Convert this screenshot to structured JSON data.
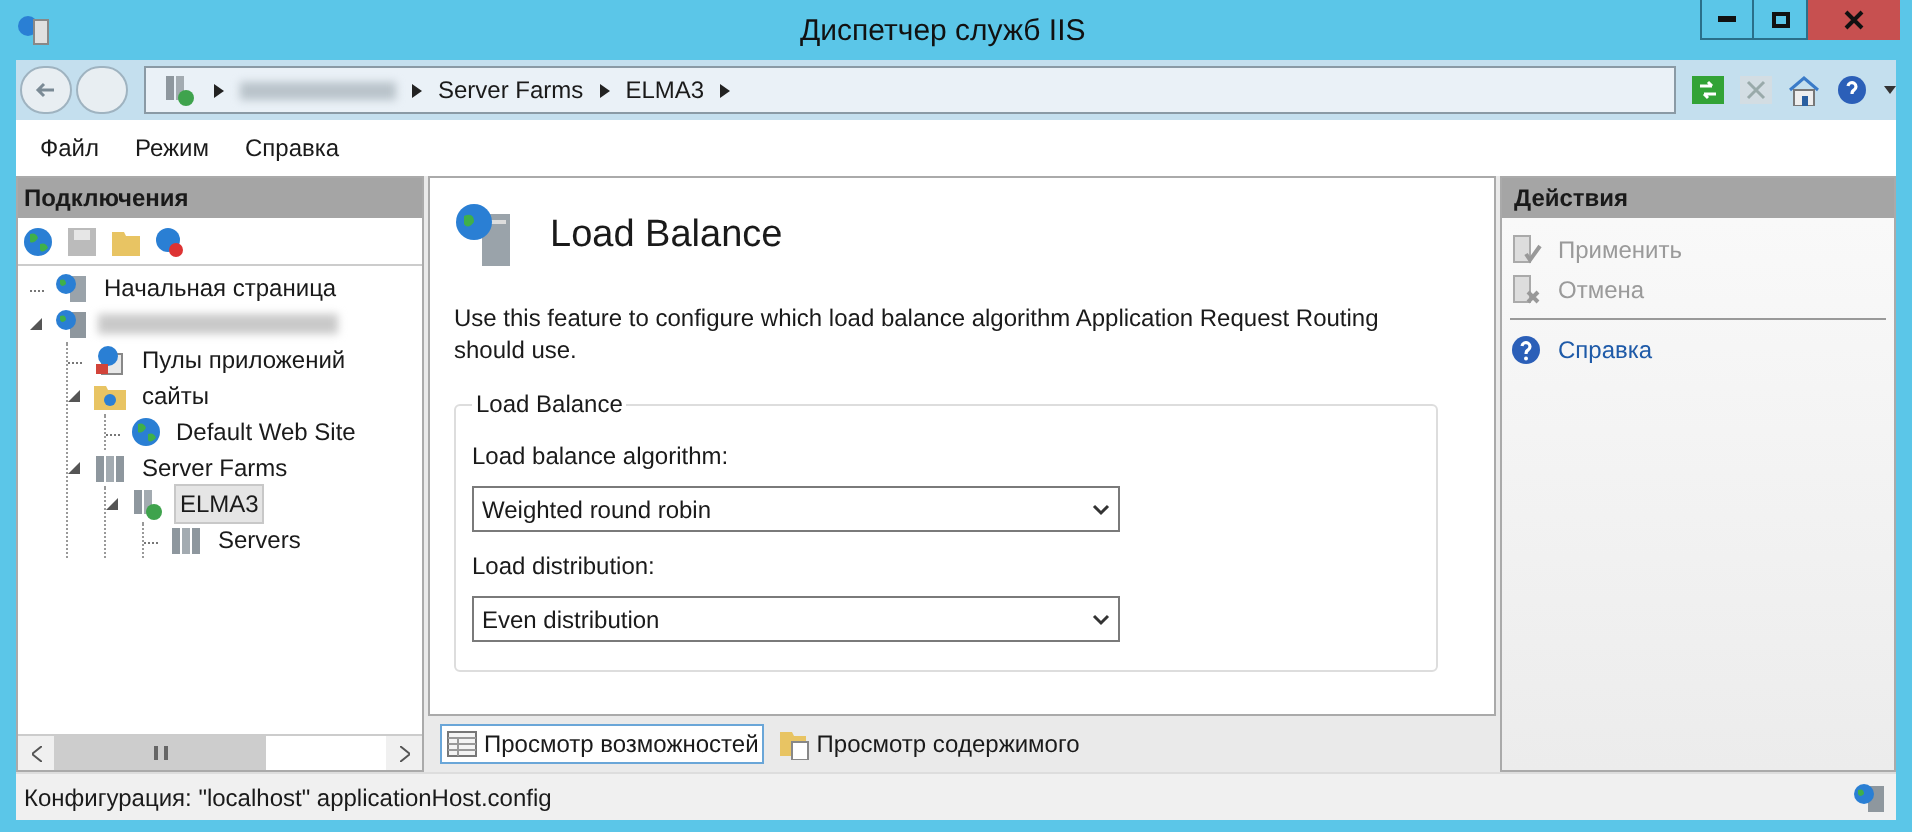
{
  "window": {
    "title": "Диспетчер служб IIS"
  },
  "address_bar": {
    "crumbs": [
      {
        "kind": "redacted"
      },
      {
        "kind": "text",
        "label": "Server Farms"
      },
      {
        "kind": "text",
        "label": "ELMA3"
      }
    ]
  },
  "menu": [
    {
      "label": "Файл"
    },
    {
      "label": "Режим"
    },
    {
      "label": "Справка"
    }
  ],
  "connections": {
    "title": "Подключения",
    "tree": [
      {
        "label": "Начальная страница",
        "kind": "home",
        "expanded": false
      },
      {
        "kind": "server",
        "expanded": true,
        "children": [
          {
            "label": "Пулы приложений",
            "kind": "pool",
            "expanded": false
          },
          {
            "label": "сайты",
            "kind": "folder",
            "expanded": true,
            "children": [
              {
                "label": "Default Web Site",
                "kind": "globe",
                "expanded": false
              }
            ]
          },
          {
            "label": "Server Farms",
            "kind": "farm",
            "expanded": true,
            "children": [
              {
                "label": "ELMA3",
                "kind": "farmnode",
                "expanded": true,
                "selected": true,
                "children": [
                  {
                    "label": "Servers",
                    "kind": "farm",
                    "expanded": false,
                    "selected": false
                  }
                ]
              }
            ]
          }
        ]
      }
    ]
  },
  "feature": {
    "title": "Load Balance",
    "description": "Use this feature to configure which load balance algorithm Application Request Routing should use.",
    "group": "Load Balance",
    "fields": [
      {
        "label": "Load balance algorithm:",
        "value": "Weighted round robin"
      },
      {
        "label": "Load distribution:",
        "value": "Even distribution"
      }
    ]
  },
  "view_tabs": [
    {
      "label": "Просмотр возможностей",
      "selected": true
    },
    {
      "label": "Просмотр содержимого",
      "selected": false
    }
  ],
  "actions": {
    "title": "Действия",
    "items": [
      {
        "label": "Применить",
        "kind": "apply",
        "disabled": true
      },
      {
        "label": "Отмена",
        "kind": "cancel",
        "disabled": true
      },
      {
        "label": "Справка",
        "kind": "help",
        "disabled": false
      }
    ]
  },
  "status_bar": "Конфигурация: \"localhost\" applicationHost.config"
}
